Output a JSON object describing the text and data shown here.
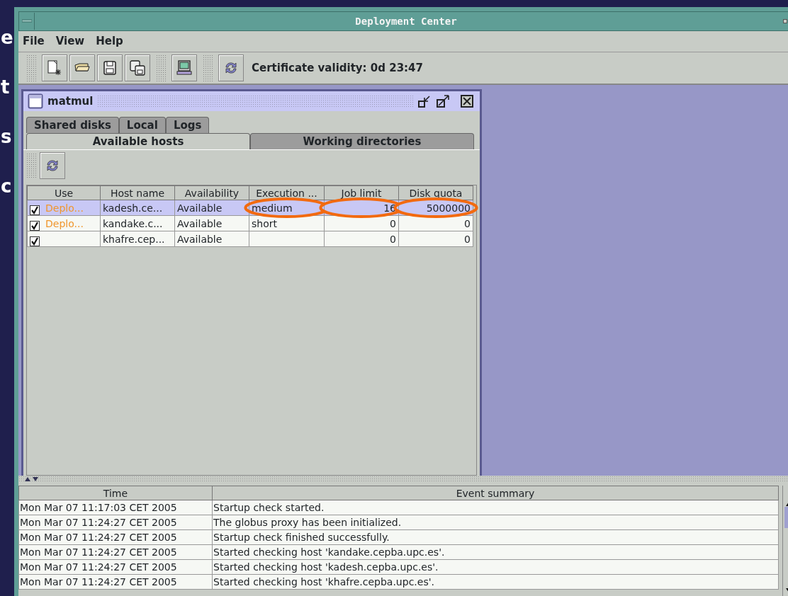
{
  "slide_fragments": [
    "e",
    "t",
    "s",
    "c"
  ],
  "window": {
    "title": "Deployment Center"
  },
  "menu": [
    "File",
    "View",
    "Help"
  ],
  "toolbar": {
    "status": "Certificate validity: 0d 23:47"
  },
  "internal_frame": {
    "title": "matmul",
    "tabs": [
      [
        {
          "label": "Shared disks",
          "selected": false
        },
        {
          "label": "Local",
          "selected": false
        },
        {
          "label": "Logs",
          "selected": false
        }
      ],
      [
        {
          "label": "Available hosts",
          "selected": true
        },
        {
          "label": "Working directories",
          "selected": false
        }
      ]
    ],
    "table": {
      "use_column": "Use",
      "columns": [
        "Host name",
        "Availability",
        "Execution ...",
        "Job limit",
        "Disk quota"
      ],
      "rows": [
        {
          "checked": true,
          "selected": true,
          "use": "Deplo...",
          "cells": [
            {
              "text": "kadesh.ce...",
              "circled": false
            },
            {
              "text": "Available",
              "circled": false
            },
            {
              "text": "medium",
              "circled": true
            },
            {
              "text": "16",
              "circled": true
            },
            {
              "text": "5000000",
              "circled": true
            }
          ]
        },
        {
          "checked": true,
          "selected": false,
          "use": "Deplo...",
          "cells": [
            {
              "text": "kandake.c...",
              "circled": false
            },
            {
              "text": "Available",
              "circled": false
            },
            {
              "text": "short",
              "circled": false
            },
            {
              "text": "0",
              "circled": false
            },
            {
              "text": "0",
              "circled": false
            }
          ]
        },
        {
          "checked": true,
          "selected": false,
          "use": "",
          "cells": [
            {
              "text": "khafre.cep...",
              "circled": false
            },
            {
              "text": "Available",
              "circled": false
            },
            {
              "text": "",
              "circled": false
            },
            {
              "text": "0",
              "circled": false
            },
            {
              "text": "0",
              "circled": false
            }
          ]
        }
      ]
    }
  },
  "log": {
    "columns": [
      "Time",
      "Event summary"
    ],
    "rows": [
      [
        "Mon Mar 07 11:17:03 CET 2005",
        "Startup check started."
      ],
      [
        "Mon Mar 07 11:24:27 CET 2005",
        "The globus proxy has been initialized."
      ],
      [
        "Mon Mar 07 11:24:27 CET 2005",
        "Startup check finished successfully."
      ],
      [
        "Mon Mar 07 11:24:27 CET 2005",
        "Started checking host 'kandake.cepba.upc.es'."
      ],
      [
        "Mon Mar 07 11:24:27 CET 2005",
        "Started checking host 'kadesh.cepba.upc.es'."
      ],
      [
        "Mon Mar 07 11:24:27 CET 2005",
        "Started checking host 'khafre.cepba.upc.es'."
      ]
    ]
  }
}
